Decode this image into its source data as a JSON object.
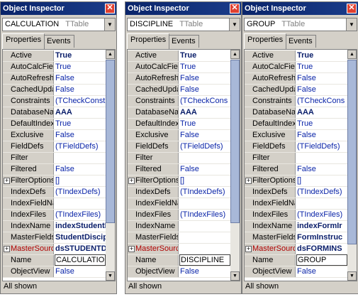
{
  "title": "Object Inspector",
  "close_glyph": "✕",
  "tabs": {
    "properties": "Properties",
    "events": "Events"
  },
  "class_name": "TTable",
  "status": "All shown",
  "property_names": [
    "Active",
    "AutoCalcFields",
    "AutoRefresh",
    "CachedUpdates",
    "Constraints",
    "DatabaseName",
    "DefaultIndex",
    "Exclusive",
    "FieldDefs",
    "Filter",
    "Filtered",
    "FilterOptions",
    "IndexDefs",
    "IndexFieldNames",
    "IndexFiles",
    "IndexName",
    "MasterFields",
    "MasterSource",
    "Name",
    "ObjectView"
  ],
  "panels": [
    {
      "object": "CALCULATION",
      "values": [
        "True",
        "True",
        "False",
        "False",
        "(TCheckConstra",
        "AAA",
        "True",
        "False",
        "(TFieldDefs)",
        "",
        "False",
        "[]",
        "(TIndexDefs)",
        "",
        "(TIndexFiles)",
        "indexStudentI",
        "StudentDiscip",
        "dsSTUDENTD",
        "CALCULATION",
        "False"
      ]
    },
    {
      "object": "DISCIPLINE",
      "values": [
        "True",
        "True",
        "False",
        "False",
        "(TCheckCons",
        "AAA",
        "True",
        "False",
        "(TFieldDefs)",
        "",
        "False",
        "[]",
        "(TIndexDefs)",
        "",
        "(TIndexFiles)",
        "",
        "",
        "",
        "DISCIPLINE",
        "False"
      ]
    },
    {
      "object": "GROUP",
      "values": [
        "True",
        "True",
        "False",
        "False",
        "(TCheckCons",
        "AAA",
        "True",
        "False",
        "(TFieldDefs)",
        "",
        "False",
        "[]",
        "(TIndexDefs)",
        "",
        "(TIndexFiles)",
        "indexFormIr",
        "FormInstruc",
        "dsFORMINS",
        "GROUP",
        "False"
      ]
    }
  ],
  "bold_rows": [
    0,
    5,
    15,
    16,
    17
  ],
  "expandable_rows": [
    11,
    17
  ],
  "red_rows": [
    17
  ],
  "edit_row": 18,
  "colors": {
    "titlebar": "#0a246a",
    "value_text": "#0a24a8",
    "close": "#e04030"
  }
}
